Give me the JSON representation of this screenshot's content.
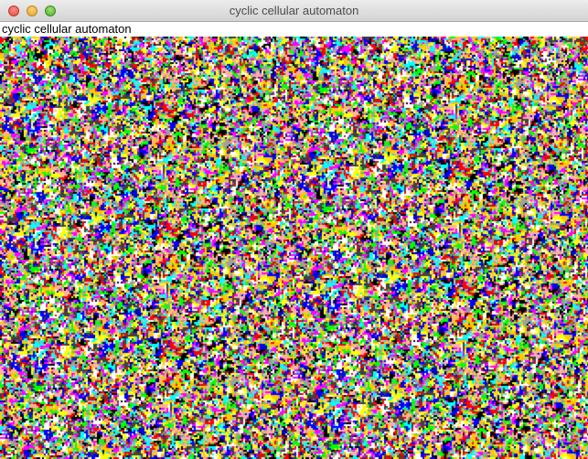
{
  "window": {
    "title": "cyclic cellular automaton"
  },
  "header": {
    "label": "cyclic cellular automaton"
  },
  "automaton": {
    "palette": [
      "#ff0000",
      "#ffff00",
      "#00ff00",
      "#00ffff",
      "#0000ff",
      "#ffb0a8",
      "#ffffff",
      "#a0a0a0",
      "#404040",
      "#000000",
      "#ffc800",
      "#ff00ff"
    ]
  }
}
